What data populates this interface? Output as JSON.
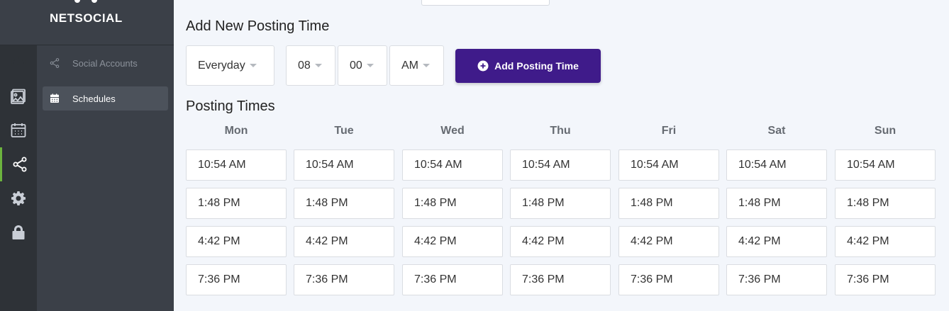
{
  "brand": {
    "name": "NETSOCIAL"
  },
  "rail": {
    "items": [
      {
        "icon": "dashboard-icon"
      },
      {
        "icon": "image-icon"
      },
      {
        "icon": "calendar-icon"
      },
      {
        "icon": "share-icon",
        "active": true
      },
      {
        "icon": "gear-icon"
      },
      {
        "icon": "lock-icon"
      }
    ]
  },
  "sidebar": {
    "items": [
      {
        "label": "Social Accounts",
        "icon": "share-icon"
      },
      {
        "label": "Schedules",
        "icon": "calendar-icon",
        "active": true
      }
    ]
  },
  "form": {
    "title": "Add New Posting Time",
    "frequency": "Everyday",
    "hour": "08",
    "minute": "00",
    "meridiem": "AM",
    "add_label": "Add Posting Time"
  },
  "schedule": {
    "title": "Posting Times",
    "days": [
      {
        "name": "Mon",
        "times": [
          "10:54 AM",
          "1:48 PM",
          "4:42 PM",
          "7:36 PM"
        ]
      },
      {
        "name": "Tue",
        "times": [
          "10:54 AM",
          "1:48 PM",
          "4:42 PM",
          "7:36 PM"
        ]
      },
      {
        "name": "Wed",
        "times": [
          "10:54 AM",
          "1:48 PM",
          "4:42 PM",
          "7:36 PM"
        ]
      },
      {
        "name": "Thu",
        "times": [
          "10:54 AM",
          "1:48 PM",
          "4:42 PM",
          "7:36 PM"
        ]
      },
      {
        "name": "Fri",
        "times": [
          "10:54 AM",
          "1:48 PM",
          "4:42 PM",
          "7:36 PM"
        ]
      },
      {
        "name": "Sat",
        "times": [
          "10:54 AM",
          "1:48 PM",
          "4:42 PM",
          "7:36 PM"
        ]
      },
      {
        "name": "Sun",
        "times": [
          "10:54 AM",
          "1:48 PM",
          "4:42 PM",
          "7:36 PM"
        ]
      }
    ]
  },
  "colors": {
    "accent": "#3f1b8a",
    "active_indicator": "#6cb33e",
    "rail": "#2e3237",
    "sidebar": "#3b4048"
  }
}
